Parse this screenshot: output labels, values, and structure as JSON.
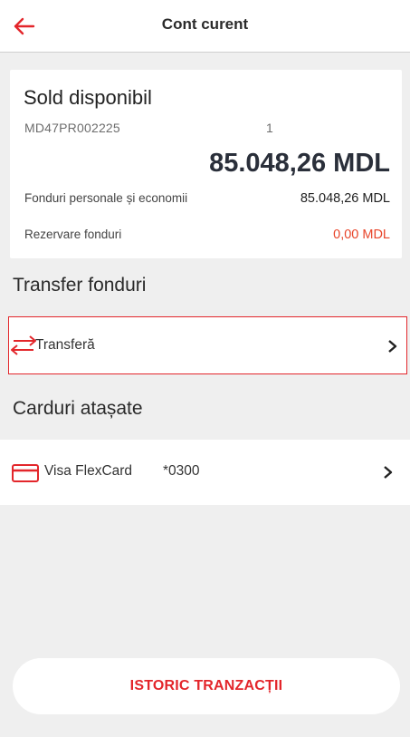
{
  "header": {
    "title": "Cont curent"
  },
  "balance": {
    "title": "Sold disponibil",
    "iban_prefix": "MD47PR002225",
    "iban_suffix": "1",
    "amount": "85.048,26 MDL",
    "rows": [
      {
        "label": "Fonduri personale și economii",
        "value": "85.048,26 MDL"
      },
      {
        "label": "Rezervare fonduri",
        "value": "0,00 MDL"
      }
    ]
  },
  "sections": {
    "transfer_title": "Transfer fonduri",
    "cards_title": "Carduri atașate"
  },
  "transfer": {
    "label": "Transferă",
    "icon": "transfer-arrows-icon"
  },
  "card_item": {
    "name": "Visa FlexCard",
    "masked_number": "*0300",
    "icon": "credit-card-icon"
  },
  "history_button": {
    "label": "ISTORIC TRANZACȚII"
  },
  "colors": {
    "accent": "#e3262b",
    "reserve": "#e8452a",
    "background": "#efefef"
  }
}
